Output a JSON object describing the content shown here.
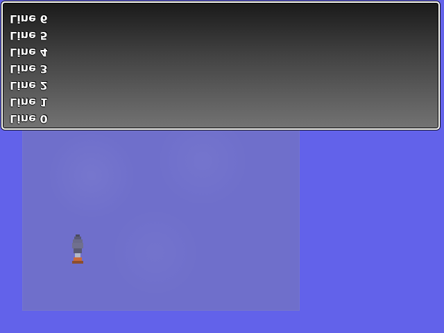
{
  "window": {
    "lines": [
      "Line 0",
      "Line 1",
      "Line 2",
      "Line 3",
      "Line 4",
      "Line 5",
      "Line 6"
    ]
  },
  "map": {
    "sprite": "character-sprite"
  }
}
